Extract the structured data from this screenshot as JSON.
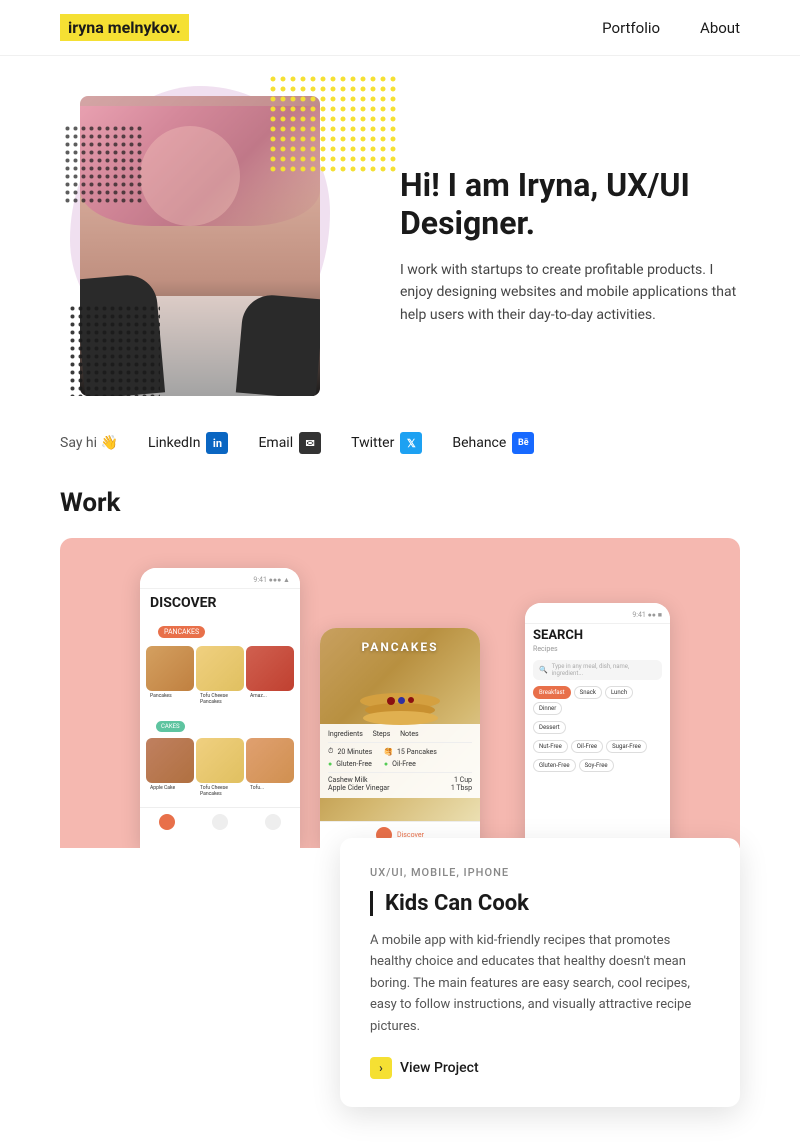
{
  "nav": {
    "logo": "iryna melnykov.",
    "links": [
      {
        "label": "Portfolio",
        "href": "#"
      },
      {
        "label": "About",
        "href": "#"
      }
    ]
  },
  "hero": {
    "title": "Hi! I am Iryna, UX/UI Designer.",
    "subtitle": "I work with startups to create profitable products. I enjoy designing websites and mobile applications that help users with their day-to-day activities."
  },
  "social": {
    "say_hi_label": "Say hi 👋",
    "links": [
      {
        "label": "LinkedIn",
        "icon": "in",
        "platform": "linkedin"
      },
      {
        "label": "Email",
        "icon": "✉",
        "platform": "email"
      },
      {
        "label": "Twitter",
        "icon": "🐦",
        "platform": "twitter"
      },
      {
        "label": "Behance",
        "icon": "Bē",
        "platform": "behance"
      }
    ]
  },
  "work": {
    "section_title": "Work",
    "project": {
      "tags": "UX/UI, MOBILE, IPHONE",
      "name": "Kids Can Cook",
      "description": "A mobile app with kid-friendly recipes that promotes healthy choice and educates that healthy doesn't mean boring. The main features are easy search, cool recipes, easy to follow instructions, and visually attractive recipe pictures.",
      "view_label": "View Project"
    },
    "screen1": {
      "title": "DISCOVER",
      "tag": "PANCAKES"
    },
    "screen2": {
      "label": "PANCAKES"
    },
    "screen3": {
      "title": "SEARCH",
      "subtitle": "Recipes",
      "search_placeholder": "Type in any meal, dish, name, ingredient...",
      "filters": [
        "Breakfast",
        "Snack",
        "Lunch",
        "Dinner",
        "Dessert",
        "Nut-Free",
        "Oil-Free",
        "Sugar-Free",
        "Gluten-Free",
        "Soy-Free"
      ]
    }
  }
}
